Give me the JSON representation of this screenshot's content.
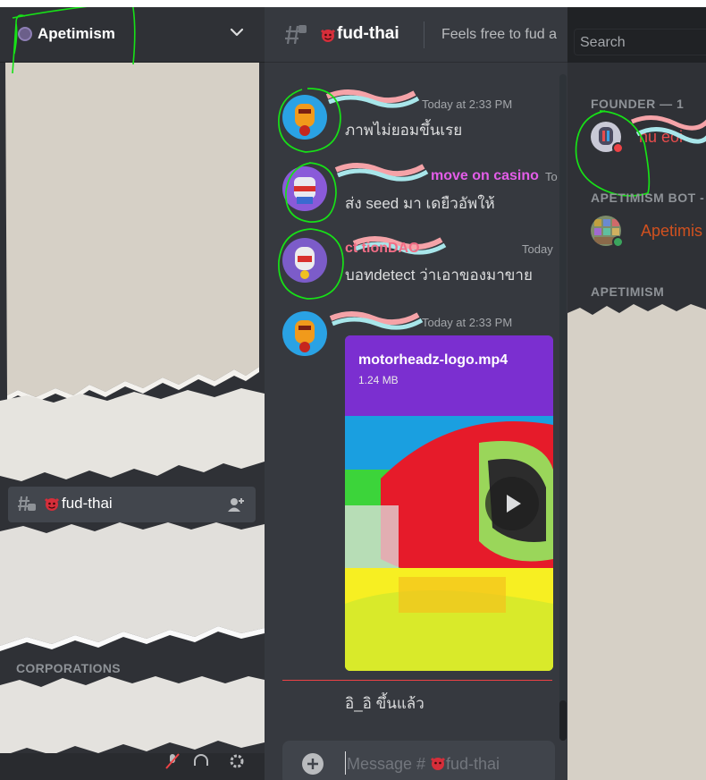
{
  "server": {
    "name": "Apetimism"
  },
  "sidebar": {
    "active_channel": "fud-thai",
    "category": "CORPORATIONS"
  },
  "channel": {
    "name": "fud-thai",
    "topic": "Feels free to fud a"
  },
  "messages": [
    {
      "author": "",
      "author_color": "#f47fff",
      "time": "Today at 2:33 PM",
      "text": "ภาพไม่ยอมขึ้นเรย"
    },
    {
      "author": "move on casino",
      "author_color": "#e35de8",
      "time": "To",
      "text": "ส่ง seed มา เดยืวอัพให้"
    },
    {
      "author": "ct          tionDAO",
      "author_color": "#f26d86",
      "time": "Today",
      "text": "บอทdetect ว่าเอาของมาขาย"
    },
    {
      "author": "",
      "author_color": "#f26d86",
      "time": "Today at 2:33 PM",
      "attachment": {
        "filename": "motorheadz-logo.mp4",
        "size": "1.24 MB"
      }
    }
  ],
  "new_message_text": "อิ_อิ  ขึ้นแล้ว",
  "composer": {
    "placeholder_prefix": "Message #",
    "placeholder_channel": "fud-thai"
  },
  "member_list": {
    "search_placeholder": "Search",
    "groups": [
      {
        "heading": "FOUNDER — 1",
        "members": [
          {
            "name": "nu   eoi",
            "color": "#e84c4c",
            "status": "dnd"
          }
        ]
      },
      {
        "heading": "APETIMISM BOT -",
        "members": [
          {
            "name": "Apetimis",
            "color": "#d1511f",
            "status": "online"
          }
        ]
      },
      {
        "heading": "APETIMISM",
        "members": []
      }
    ]
  },
  "colors": {
    "accent_green_annotation": "#17e117",
    "divider_red": "#ed4245",
    "online": "#3ba55d",
    "dnd": "#ed4245"
  }
}
